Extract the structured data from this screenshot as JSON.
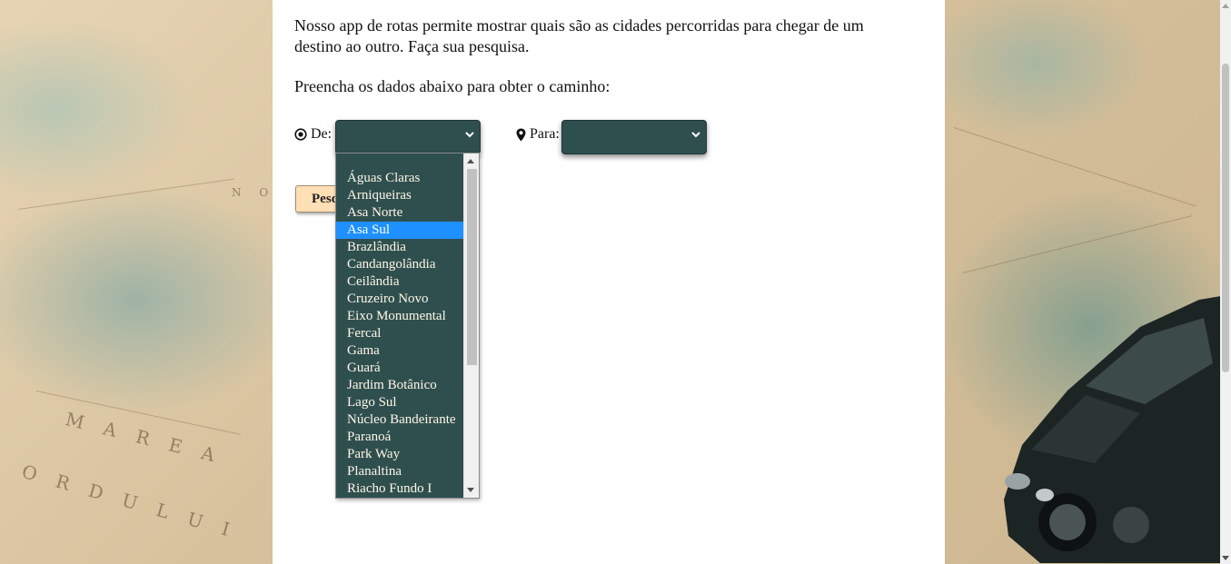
{
  "intro_text": "Nosso app de rotas permite mostrar quais são as cidades percorridas para chegar de um destino ao outro. Faça sua pesquisa.",
  "prompt_text": "Preencha os dados abaixo para obter o caminho:",
  "from_field": {
    "label": "De:",
    "icon": "target-icon",
    "value": ""
  },
  "to_field": {
    "label": "Para:",
    "icon": "map-pin-icon",
    "value": ""
  },
  "search_button": {
    "label": "Pesquisar"
  },
  "from_options": [
    "",
    "Águas Claras",
    "Arniqueiras",
    "Asa Norte",
    "Asa Sul",
    "Brazlândia",
    "Candangolândia",
    "Ceilândia",
    "Cruzeiro Novo",
    "Eixo Monumental",
    "Fercal",
    "Gama",
    "Guará",
    "Jardim Botânico",
    "Lago Sul",
    "Núcleo Bandeirante",
    "Paranoá",
    "Park Way",
    "Planaltina",
    "Riacho Fundo I"
  ],
  "highlighted_option": "Asa Sul",
  "colors": {
    "select_bg": "#2f4f4f",
    "highlight": "#1e90ff",
    "button_bg": "#ffdfb5",
    "option_text": "#fff7e6"
  },
  "background_labels": [
    "M A R E A",
    "O R D U L U I",
    "N O"
  ]
}
